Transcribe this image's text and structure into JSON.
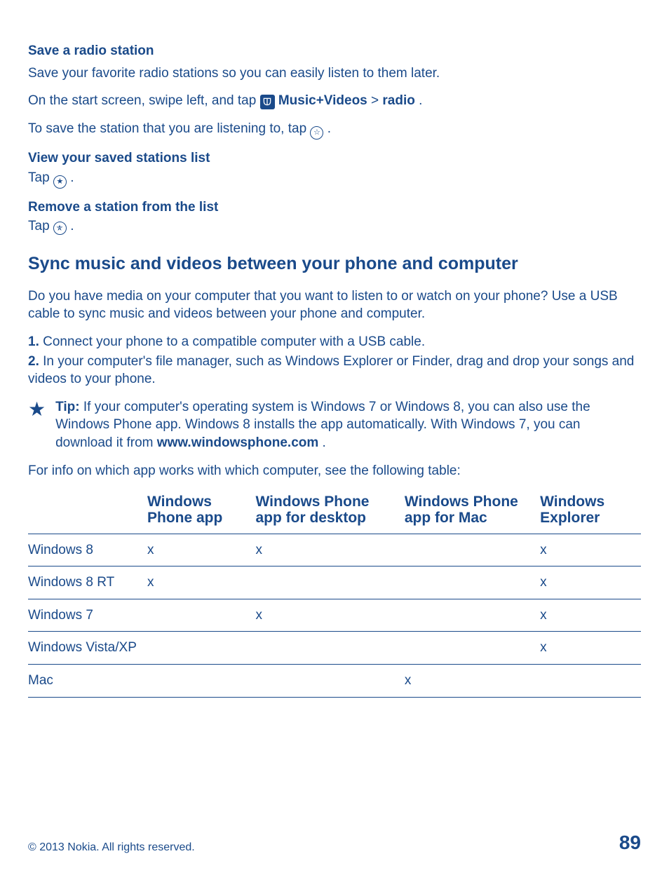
{
  "section1": {
    "title": "Save a radio station",
    "intro": "Save your favorite radio stations so you can easily listen to them later.",
    "line2_pre": "On the start screen, swipe left, and tap ",
    "line2_app": "Music+Videos",
    "line2_sep": " > ",
    "line2_radio": "radio",
    "line2_post": ".",
    "line3_pre": "To save the station that you are listening to, tap ",
    "line3_post": "."
  },
  "sub_a": {
    "title": "View your saved stations list",
    "tap_pre": "Tap ",
    "tap_post": "."
  },
  "sub_b": {
    "title": "Remove a station from the list",
    "tap_pre": "Tap ",
    "tap_post": "."
  },
  "section2": {
    "heading": "Sync music and videos between your phone and computer",
    "intro": "Do you have media on your computer that you want to listen to or watch on your phone? Use a USB cable to sync music and videos between your phone and computer.",
    "step1_num": "1.",
    "step1": " Connect your phone to a compatible computer with a USB cable.",
    "step2_num": "2.",
    "step2": " In your computer's file manager, such as Windows Explorer or Finder, drag and drop your songs and videos to your phone.",
    "tip_label": "Tip:",
    "tip_body_pre": " If your computer's operating system is Windows 7 or Windows 8, you can also use the Windows Phone app. Windows 8 installs the app automatically. With Windows 7, you can download it from ",
    "tip_link": "www.windowsphone.com",
    "tip_body_post": ".",
    "table_lead": "For info on which app works with which computer, see the following table:"
  },
  "chart_data": {
    "type": "table",
    "title": "App compatibility by operating system",
    "columns": [
      "",
      "Windows Phone app",
      "Windows Phone app for desktop",
      "Windows Phone app for Mac",
      "Windows Explorer"
    ],
    "rows": [
      {
        "label": "Windows 8",
        "cells": [
          "x",
          "x",
          "",
          "x"
        ]
      },
      {
        "label": "Windows 8 RT",
        "cells": [
          "x",
          "",
          "",
          "x"
        ]
      },
      {
        "label": "Windows 7",
        "cells": [
          "",
          "x",
          "",
          "x"
        ]
      },
      {
        "label": "Windows Vista/XP",
        "cells": [
          "",
          "",
          "",
          "x"
        ]
      },
      {
        "label": "Mac",
        "cells": [
          "",
          "",
          "x",
          ""
        ]
      }
    ]
  },
  "footer": {
    "copyright": "© 2013 Nokia. All rights reserved.",
    "page": "89"
  }
}
